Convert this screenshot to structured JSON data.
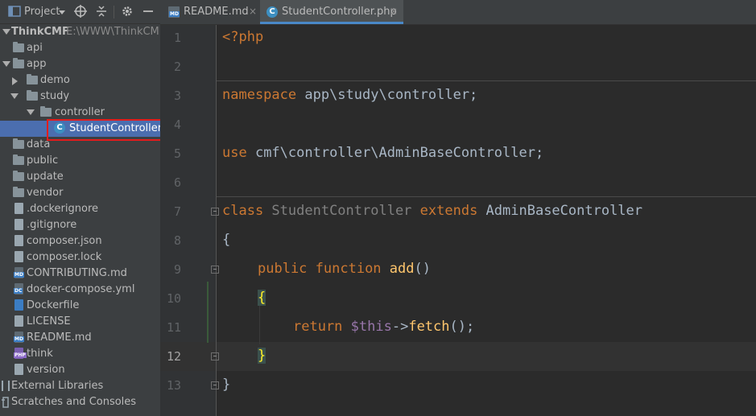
{
  "project_header": {
    "title": "Project"
  },
  "tree": {
    "root": {
      "name": "ThinkCMF",
      "path": "E:\\WWW\\ThinkCMF"
    },
    "items": [
      {
        "label": "api"
      },
      {
        "label": "app"
      },
      {
        "label": "demo"
      },
      {
        "label": "study"
      },
      {
        "label": "controller"
      },
      {
        "label": "StudentController.php"
      },
      {
        "label": "data"
      },
      {
        "label": "public"
      },
      {
        "label": "update"
      },
      {
        "label": "vendor"
      },
      {
        "label": ".dockerignore"
      },
      {
        "label": ".gitignore"
      },
      {
        "label": "composer.json"
      },
      {
        "label": "composer.lock"
      },
      {
        "label": "CONTRIBUTING.md"
      },
      {
        "label": "docker-compose.yml"
      },
      {
        "label": "Dockerfile"
      },
      {
        "label": "LICENSE"
      },
      {
        "label": "README.md"
      },
      {
        "label": "think"
      },
      {
        "label": "version"
      },
      {
        "label": "External Libraries"
      },
      {
        "label": "Scratches and Consoles"
      }
    ],
    "file_tags": {
      "md": "MD",
      "dc": "DC",
      "php": "PHP",
      "class": "C"
    }
  },
  "tabs": [
    {
      "label": "README.md",
      "close": "×"
    },
    {
      "label": "StudentController.php",
      "close": "×"
    }
  ],
  "editor": {
    "line_numbers": [
      "1",
      "2",
      "3",
      "4",
      "5",
      "6",
      "7",
      "8",
      "9",
      "10",
      "11",
      "12",
      "13"
    ],
    "current_line": "12",
    "code": {
      "l1": "<?php",
      "l3_kw": "namespace",
      "l3_rest": " app\\study\\controller;",
      "l5_kw": "use",
      "l5_rest": " cmf\\controller\\AdminBaseController;",
      "l7_kw": "class",
      "l7_name": " StudentController ",
      "l7_kw2": "extends",
      "l7_base": " AdminBaseController",
      "l8": "{",
      "l9_kw1": "public",
      "l9_kw2": " function",
      "l9_fn": " add",
      "l9_paren": "()",
      "l10": "{",
      "l11_kw": "return",
      "l11_var": " $this",
      "l11_arrow": "->",
      "l11_fn": "fetch",
      "l11_end": "();",
      "l12": "}",
      "l13": "}"
    }
  },
  "colors": {
    "accent": "#4a88c7",
    "selection": "#4b6eaf",
    "highlight_box": "#e31c1c",
    "keyword": "#cc7832",
    "function": "#ffc66d"
  }
}
